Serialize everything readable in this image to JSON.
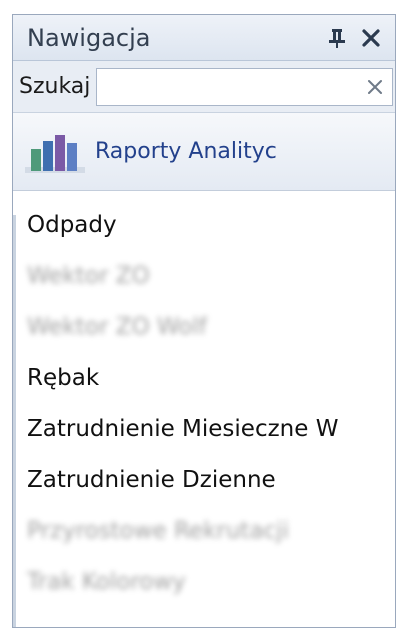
{
  "panel": {
    "title": "Nawigacja",
    "pin_icon": "pin-icon",
    "close_icon": "close-icon"
  },
  "search": {
    "label": "Szukaj",
    "value": "",
    "placeholder": "",
    "clear_icon": "clear-icon"
  },
  "group": {
    "icon": "bar-chart-icon",
    "title": "Raporty Analityc"
  },
  "items": [
    {
      "label": "Odpady",
      "blurred": false
    },
    {
      "label": "Wektor ZO",
      "blurred": true
    },
    {
      "label": "Wektor ZO Wolf",
      "blurred": true
    },
    {
      "label": "Rębak",
      "blurred": false
    },
    {
      "label": "Zatrudnienie Miesieczne W",
      "blurred": false
    },
    {
      "label": "Zatrudnienie Dzienne",
      "blurred": false
    },
    {
      "label": "Przyrostowe Rekrutacji",
      "blurred": true
    },
    {
      "label": "Trak Kolorowy",
      "blurred": true
    }
  ],
  "colors": {
    "group_title": "#23418c",
    "titlebar": "#dde5f0"
  }
}
